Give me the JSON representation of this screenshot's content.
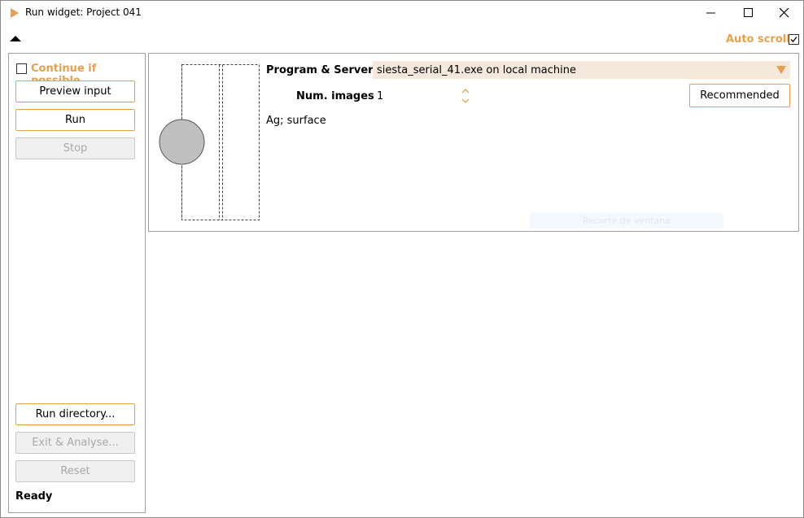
{
  "window": {
    "title": "Run widget: Project 041",
    "icon": "play-triangle-icon",
    "accent_color": "#e8a04c"
  },
  "toolbar": {
    "auto_scroll_label": "Auto scroll",
    "auto_scroll_checked": true
  },
  "left_panel": {
    "continue_label": "Continue if possible",
    "continue_checked": false,
    "preview_input_label": "Preview input",
    "run_label": "Run",
    "stop_label": "Stop",
    "run_directory_label": "Run directory...",
    "exit_analyse_label": "Exit & Analyse...",
    "reset_label": "Reset",
    "status": "Ready"
  },
  "main_panel": {
    "program_server_label": "Program & Server",
    "program_server_value": "siesta_serial_41.exe on local machine",
    "num_images_label": "Num. images",
    "num_images_value": "1",
    "recommended_label": "Recommended",
    "description": "Ag; surface",
    "overlay_text": "Recorte de ventana"
  }
}
